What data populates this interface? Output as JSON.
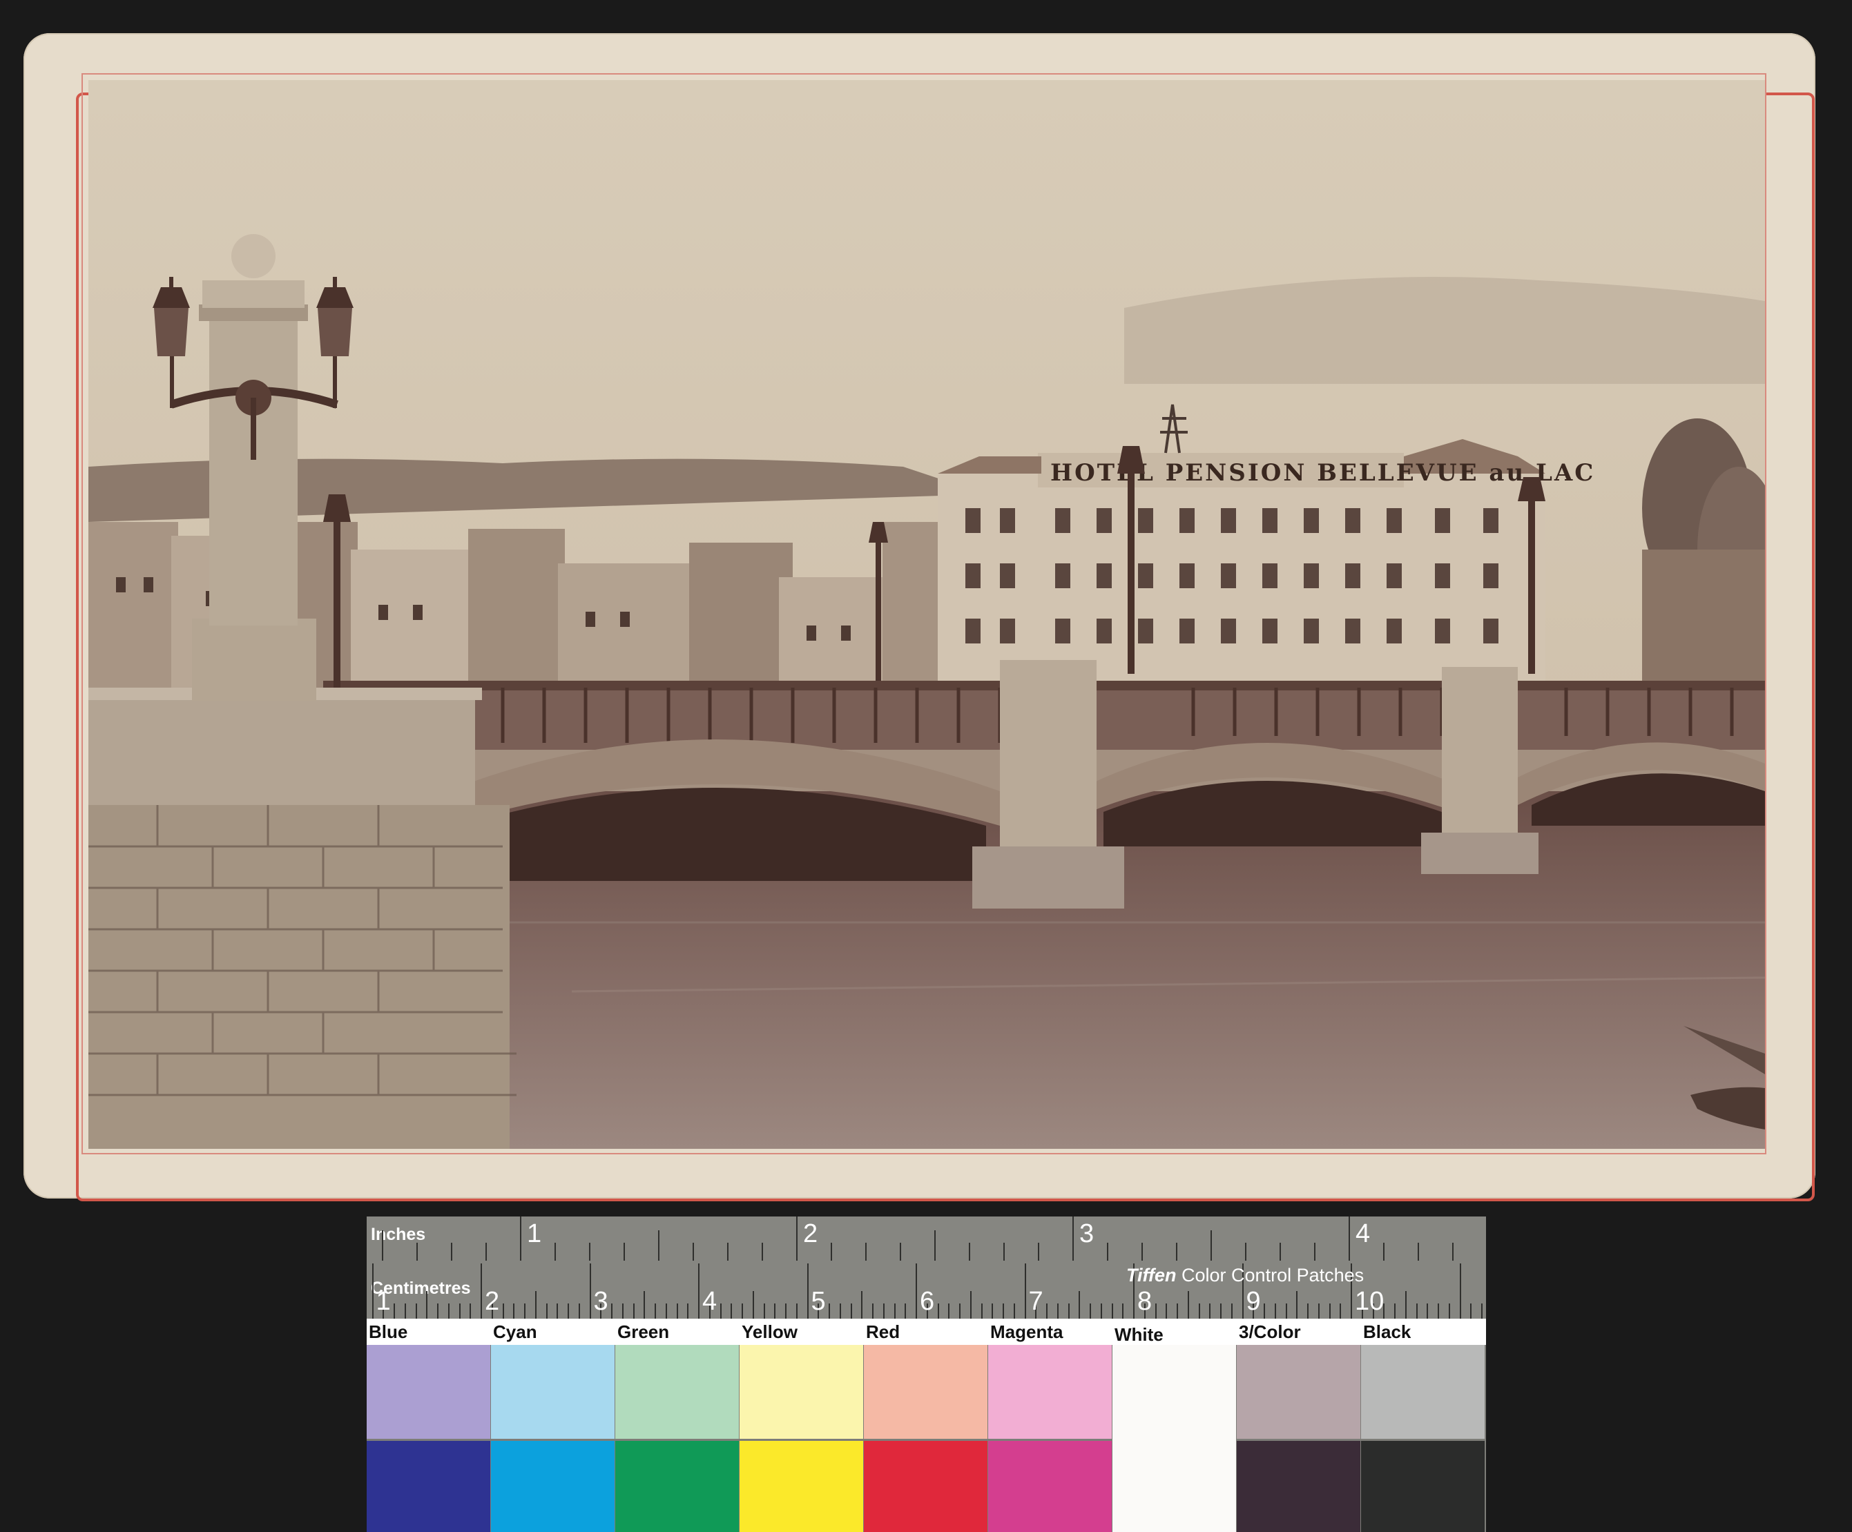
{
  "photo": {
    "sign_text": "HOTEL  PENSION BELLEVUE au LAC"
  },
  "ruler": {
    "inches_label": "Inches",
    "centimetres_label": "Centimetres",
    "inch_numbers": [
      "1",
      "2",
      "3",
      "4"
    ],
    "cm_numbers": [
      "1",
      "2",
      "3",
      "4",
      "5",
      "6",
      "7",
      "8",
      "9",
      "10"
    ],
    "brand": "Tiffen",
    "brand_suffix": " Color Control Patches"
  },
  "patches": [
    {
      "label": "Blue",
      "light": "#ab9fd2",
      "dark": "#2e3392"
    },
    {
      "label": "Cyan",
      "light": "#a7d9ef",
      "dark": "#0ca1dd"
    },
    {
      "label": "Green",
      "light": "#b1dbbd",
      "dark": "#109a57"
    },
    {
      "label": "Yellow",
      "light": "#fbf5ad",
      "dark": "#fbe92a"
    },
    {
      "label": "Red",
      "light": "#f5b9a5",
      "dark": "#e0283b"
    },
    {
      "label": "Magenta",
      "light": "#f2aed3",
      "dark": "#d43e8f"
    },
    {
      "label": "White",
      "light": "#fbfaf8",
      "dark": "#fbfaf8"
    },
    {
      "label": "3/Color",
      "light": "#b6a5a9",
      "dark": "#3b2c38"
    },
    {
      "label": "Black",
      "light": "#b8b9b8",
      "dark": "#2b2c2b"
    }
  ]
}
